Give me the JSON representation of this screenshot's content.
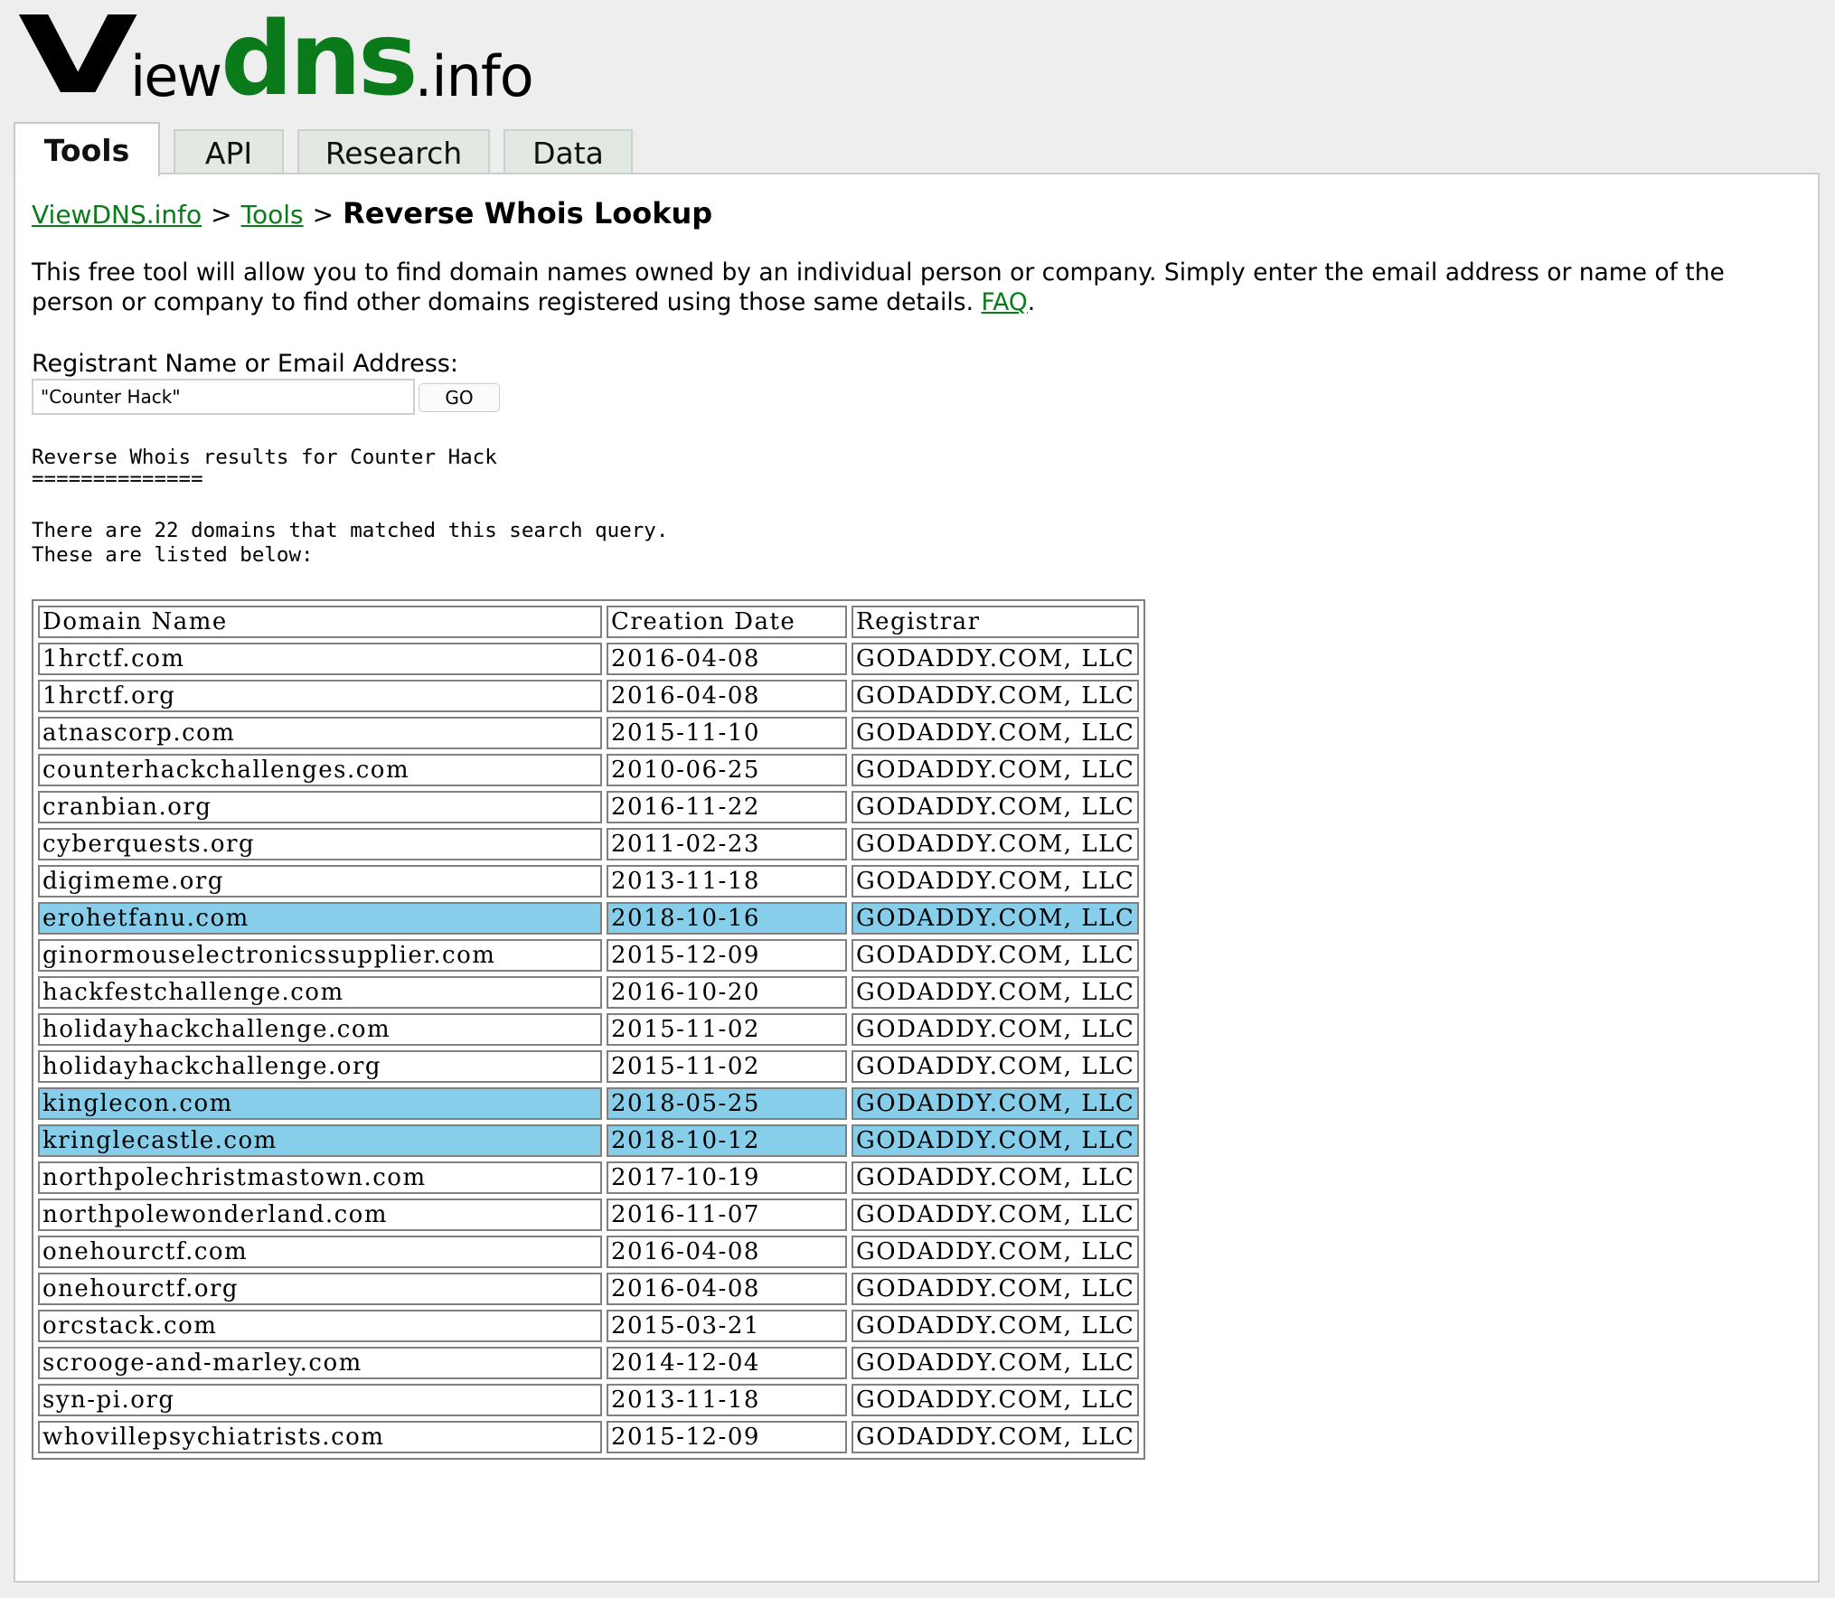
{
  "logo": {
    "v": "V",
    "iew": "iew",
    "dns": "dns",
    "info": ".info"
  },
  "tabs": [
    {
      "label": "Tools",
      "active": true
    },
    {
      "label": "API",
      "active": false
    },
    {
      "label": "Research",
      "active": false
    },
    {
      "label": "Data",
      "active": false
    }
  ],
  "breadcrumb": {
    "home": "ViewDNS.info",
    "section": "Tools",
    "separator": ">",
    "current": "Reverse Whois Lookup"
  },
  "intro": {
    "text": "This free tool will allow you to find domain names owned by an individual person or company. Simply enter the email address or name of the person or company to find other domains registered using those same details. ",
    "faq_link": "FAQ",
    "end": "."
  },
  "form": {
    "label": "Registrant Name or Email Address:",
    "value": "\"Counter Hack\"",
    "go_label": "GO"
  },
  "results": {
    "heading": "Reverse Whois results for Counter Hack",
    "underline": "==============",
    "summary_line1": "There are 22 domains that matched this search query.",
    "summary_line2": "These are listed below:",
    "columns": [
      "Domain Name",
      "Creation Date",
      "Registrar"
    ],
    "highlight_color": "#87ceeb",
    "rows": [
      {
        "domain": "1hrctf.com",
        "date": "2016-04-08",
        "registrar": "GODADDY.COM, LLC",
        "highlighted": false
      },
      {
        "domain": "1hrctf.org",
        "date": "2016-04-08",
        "registrar": "GODADDY.COM, LLC",
        "highlighted": false
      },
      {
        "domain": "atnascorp.com",
        "date": "2015-11-10",
        "registrar": "GODADDY.COM, LLC",
        "highlighted": false
      },
      {
        "domain": "counterhackchallenges.com",
        "date": "2010-06-25",
        "registrar": "GODADDY.COM, LLC",
        "highlighted": false
      },
      {
        "domain": "cranbian.org",
        "date": "2016-11-22",
        "registrar": "GODADDY.COM, LLC",
        "highlighted": false
      },
      {
        "domain": "cyberquests.org",
        "date": "2011-02-23",
        "registrar": "GODADDY.COM, LLC",
        "highlighted": false
      },
      {
        "domain": "digimeme.org",
        "date": "2013-11-18",
        "registrar": "GODADDY.COM, LLC",
        "highlighted": false
      },
      {
        "domain": "erohetfanu.com",
        "date": "2018-10-16",
        "registrar": "GODADDY.COM, LLC",
        "highlighted": true
      },
      {
        "domain": "ginormouselectronicssupplier.com",
        "date": "2015-12-09",
        "registrar": "GODADDY.COM, LLC",
        "highlighted": false
      },
      {
        "domain": "hackfestchallenge.com",
        "date": "2016-10-20",
        "registrar": "GODADDY.COM, LLC",
        "highlighted": false
      },
      {
        "domain": "holidayhackchallenge.com",
        "date": "2015-11-02",
        "registrar": "GODADDY.COM, LLC",
        "highlighted": false
      },
      {
        "domain": "holidayhackchallenge.org",
        "date": "2015-11-02",
        "registrar": "GODADDY.COM, LLC",
        "highlighted": false
      },
      {
        "domain": "kinglecon.com",
        "date": "2018-05-25",
        "registrar": "GODADDY.COM, LLC",
        "highlighted": true
      },
      {
        "domain": "kringlecastle.com",
        "date": "2018-10-12",
        "registrar": "GODADDY.COM, LLC",
        "highlighted": true
      },
      {
        "domain": "northpolechristmastown.com",
        "date": "2017-10-19",
        "registrar": "GODADDY.COM, LLC",
        "highlighted": false
      },
      {
        "domain": "northpolewonderland.com",
        "date": "2016-11-07",
        "registrar": "GODADDY.COM, LLC",
        "highlighted": false
      },
      {
        "domain": "onehourctf.com",
        "date": "2016-04-08",
        "registrar": "GODADDY.COM, LLC",
        "highlighted": false
      },
      {
        "domain": "onehourctf.org",
        "date": "2016-04-08",
        "registrar": "GODADDY.COM, LLC",
        "highlighted": false
      },
      {
        "domain": "orcstack.com",
        "date": "2015-03-21",
        "registrar": "GODADDY.COM, LLC",
        "highlighted": false
      },
      {
        "domain": "scrooge-and-marley.com",
        "date": "2014-12-04",
        "registrar": "GODADDY.COM, LLC",
        "highlighted": false
      },
      {
        "domain": "syn-pi.org",
        "date": "2013-11-18",
        "registrar": "GODADDY.COM, LLC",
        "highlighted": false
      },
      {
        "domain": "whovillepsychiatrists.com",
        "date": "2015-12-09",
        "registrar": "GODADDY.COM, LLC",
        "highlighted": false
      }
    ]
  }
}
